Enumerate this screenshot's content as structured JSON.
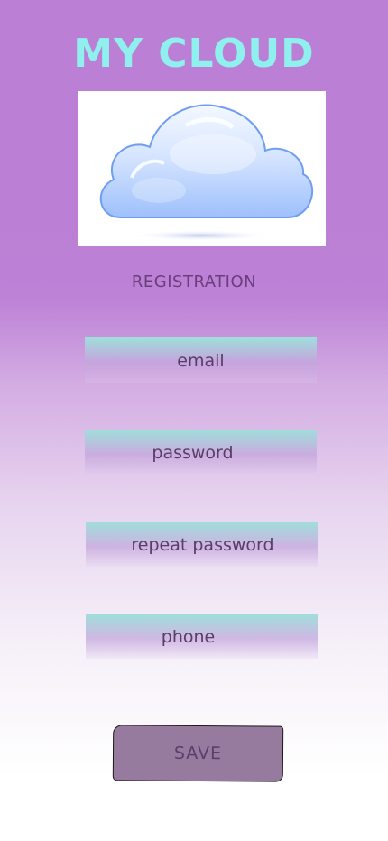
{
  "app": {
    "title": "MY CLOUD"
  },
  "logo": {
    "icon": "cloud-icon"
  },
  "form": {
    "heading": "REGISTRATION",
    "fields": [
      {
        "label": "email"
      },
      {
        "label": "password"
      },
      {
        "label": "repeat password"
      },
      {
        "label": "phone"
      }
    ],
    "save_label": "SAVE"
  },
  "colors": {
    "title": "#8ff0ee",
    "background_top": "#bb7fd5",
    "background_bottom": "#ffffff",
    "field_top": "#9fdfdb",
    "button": "#967b9f",
    "text": "#5a3d66"
  }
}
